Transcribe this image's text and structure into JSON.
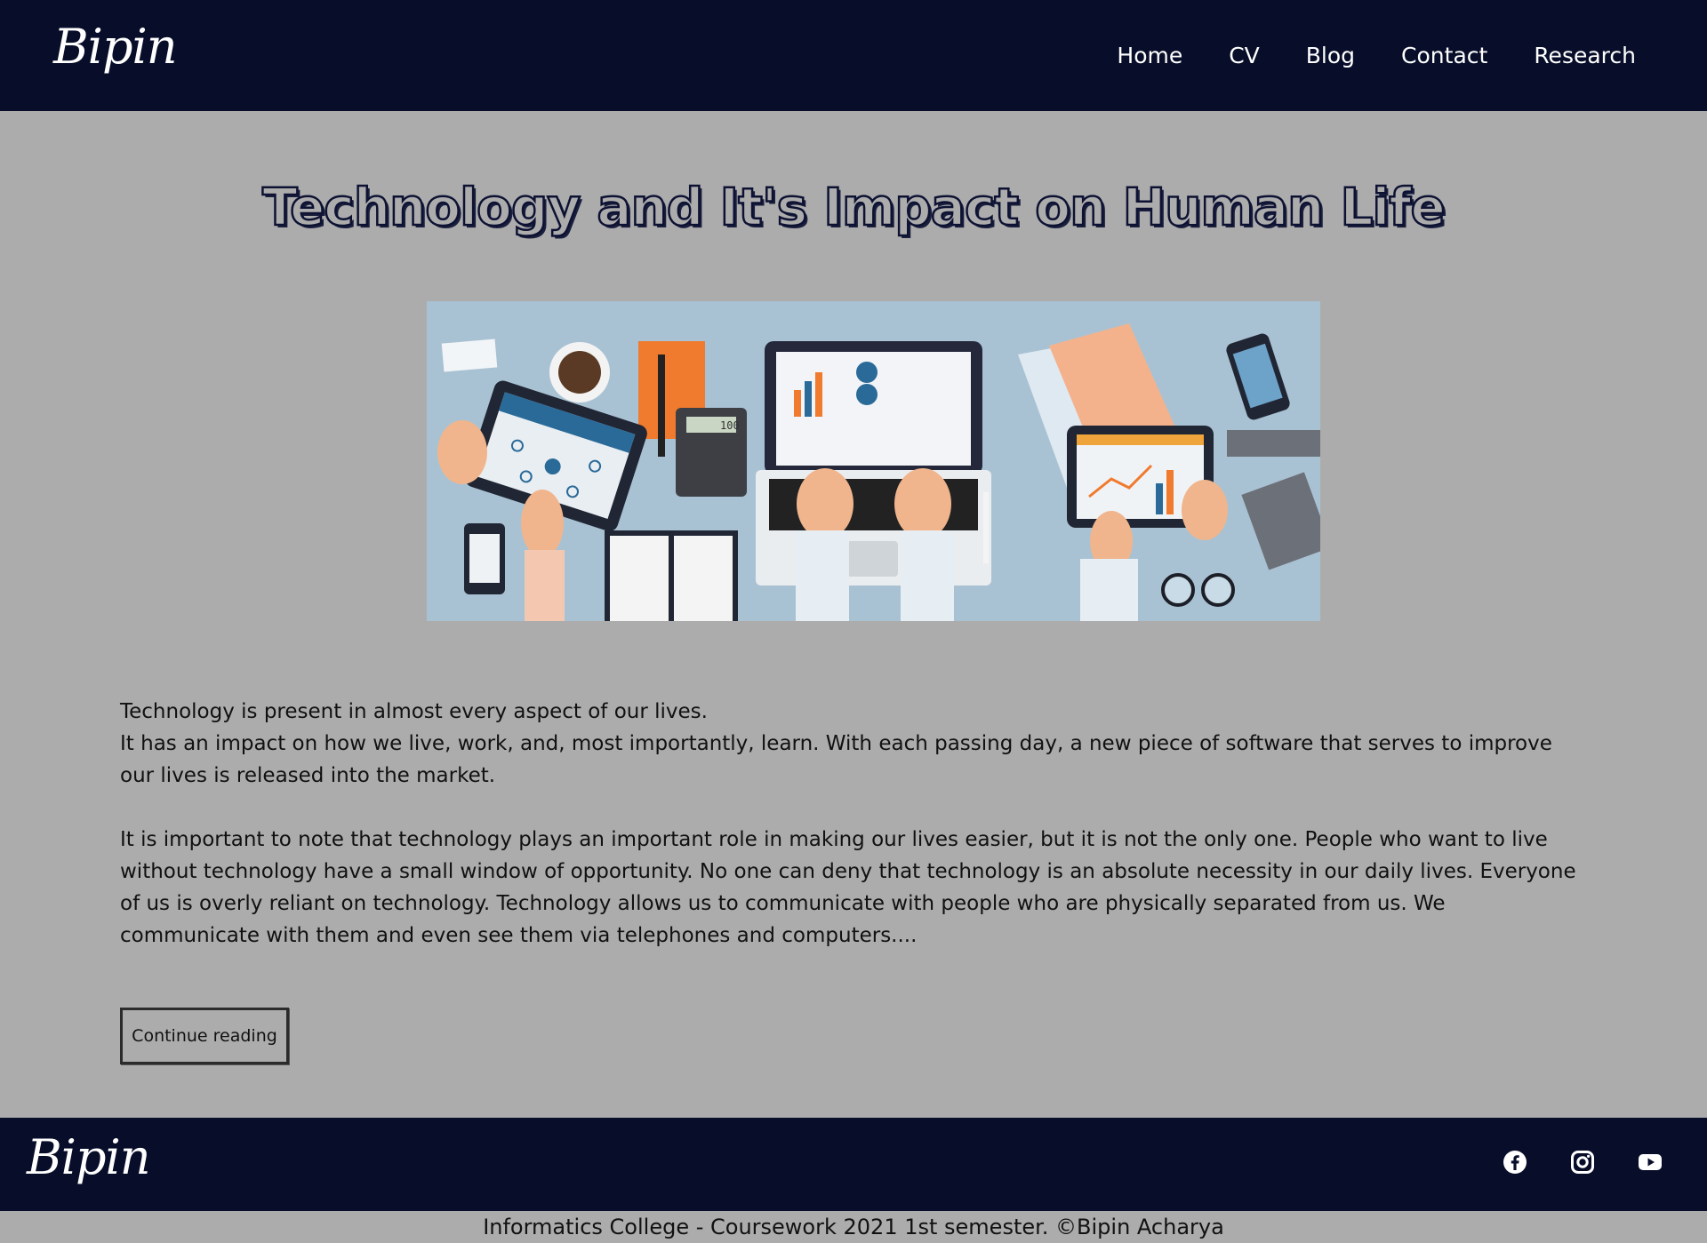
{
  "header": {
    "logo": "Bipin",
    "nav": [
      "Home",
      "CV",
      "Blog",
      "Contact",
      "Research"
    ]
  },
  "article": {
    "title": "Technology and It's Impact on Human Life",
    "paragraph1_line1": "Technology is present in almost every aspect of our lives.",
    "paragraph1_line2": "It has an impact on how we live, work, and, most importantly, learn. With each passing day, a new piece of software that serves to improve our lives is released into the market.",
    "paragraph2": "It is important to note that technology plays an important role in making our lives easier, but it is not the only one. People who want to live without technology have a small window of opportunity. No one can deny that technology is an absolute necessity in our daily lives. Everyone of us is overly reliant on technology. Technology allows us to communicate with people who are physically separated from us. We communicate with them and even see them via telephones and computers....",
    "button_label": "Continue reading",
    "calculator_display": "100"
  },
  "footer": {
    "logo": "Bipin",
    "social_icons": [
      "facebook-icon",
      "instagram-icon",
      "youtube-icon"
    ],
    "copyright": "Informatics College - Coursework 2021 1st semester. ©Bipin Acharya"
  },
  "colors": {
    "navbar": "#080e2a",
    "page_background": "#acacac",
    "hero_background": "#a9c2d3"
  }
}
